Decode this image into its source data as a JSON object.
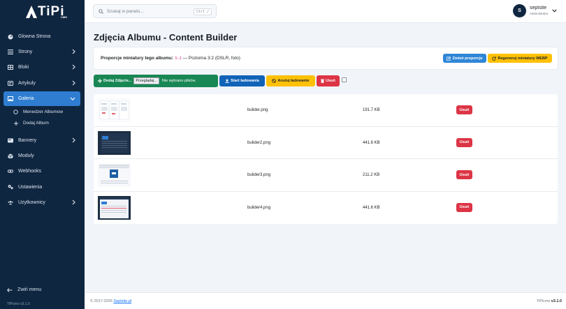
{
  "brand": {
    "logo_text": "TiPi",
    "logo_sub": "CMS"
  },
  "search": {
    "placeholder": "Szukaj w panelu...",
    "shortcut": "Ctrl /"
  },
  "user": {
    "initial": "S",
    "name": "septsite",
    "role": "Administrator"
  },
  "sidebar": {
    "items": [
      {
        "label": "Glowna Strona",
        "icon": "dashboard-icon"
      },
      {
        "label": "Strony",
        "icon": "list-icon"
      },
      {
        "label": "Bloki",
        "icon": "table-icon"
      },
      {
        "label": "Artykuly",
        "icon": "newspaper-icon"
      },
      {
        "label": "Galeria",
        "icon": "image-icon"
      },
      {
        "label": "Bannery",
        "icon": "banner-icon"
      },
      {
        "label": "Moduly",
        "icon": "cube-icon"
      },
      {
        "label": "Webhooks",
        "icon": "link-icon"
      },
      {
        "label": "Ustawienia",
        "icon": "settings-icon"
      },
      {
        "label": "Uzytkownicy",
        "icon": "users-icon"
      }
    ],
    "sub_items": [
      {
        "label": "Menedzer Albumow",
        "icon": "circle-icon"
      },
      {
        "label": "Dodaj Album",
        "icon": "plus-icon"
      }
    ],
    "collapse_label": "Zwiń menu",
    "version": "TiPicms v3.1.0"
  },
  "page": {
    "title": "Zdjęcia Albumu - Content Builder"
  },
  "proportions": {
    "label": "Proporcje miniatury tego albumu:",
    "ratio": "3:2",
    "description": "— Pozioma 3:2 (DSLR, foto)",
    "change_button": "Zmień proporcje",
    "regen_button": "Regeneruj miniatury WEBP"
  },
  "upload": {
    "add_button": "Dodaj Zdjęcie...",
    "browse_button": "Przeglądaj...",
    "no_files": "Nie wybrano plików.",
    "start_button": "Start ładowania",
    "cancel_button": "Anuluj ładowanie",
    "delete_button": "Usuń"
  },
  "files": [
    {
      "name": "bulider.png",
      "size": "191.7 KB",
      "action": "Usuń"
    },
    {
      "name": "bulider2.png",
      "size": "441.6 KB",
      "action": "Usuń"
    },
    {
      "name": "bulider3.png",
      "size": "211.2 KB",
      "action": "Usuń"
    },
    {
      "name": "bulider4.png",
      "size": "441.6 KB",
      "action": "Usuń"
    }
  ],
  "footer": {
    "copyright": "© 2017-2026",
    "link": "Septsite.pl",
    "product": "TiPicms",
    "version": "v3.1.0"
  },
  "colors": {
    "sidebar": "#0f2640",
    "active": "#2f7dd1",
    "success": "#198754",
    "primary": "#1163b8",
    "warning": "#ffc107",
    "danger": "#dc3545"
  }
}
